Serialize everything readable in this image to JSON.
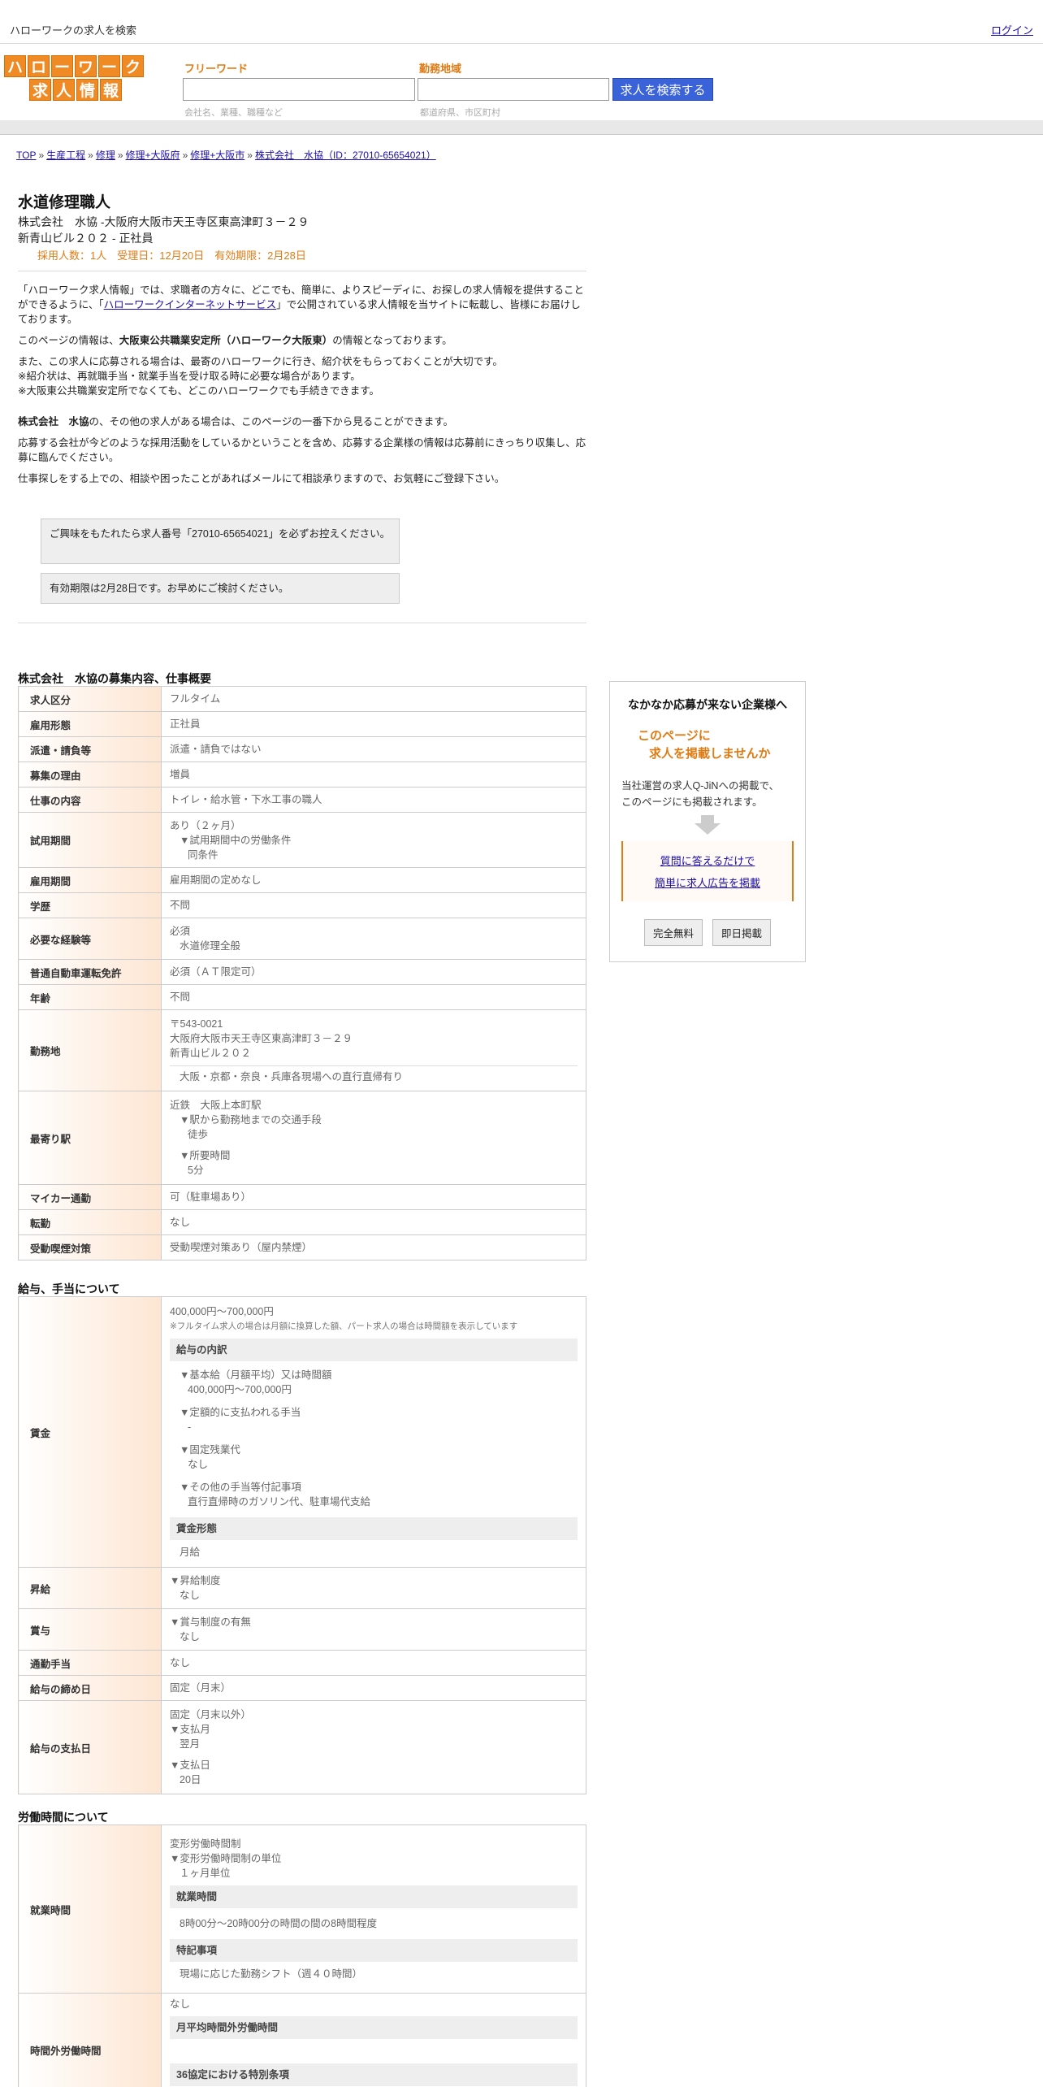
{
  "topbar": {
    "site_title": "ハローワークの求人を検索",
    "login": "ログイン"
  },
  "logo": {
    "row1": [
      "ハ",
      "ロ",
      "ー",
      "ワ",
      "ー",
      "ク"
    ],
    "row2": [
      "求",
      "人",
      "情",
      "報"
    ],
    "brand_color": "#f08a24"
  },
  "search": {
    "keyword_label": "フリーワード",
    "keyword_hint": "会社名、業種、職種など",
    "area_label": "勤務地域",
    "area_hint": "都道府県、市区町村",
    "button": "求人を検索する"
  },
  "breadcrumb": [
    "TOP",
    "生産工程",
    "修理",
    "修理+大阪府",
    "修理+大阪市",
    "株式会社　水協（ID：27010-65654021）"
  ],
  "job": {
    "title": "水道修理職人",
    "company_line1": "株式会社　水協 -大阪府大阪市天王寺区東高津町３－２９",
    "company_line2": "新青山ビル２０２ - 正社員",
    "meta": "採用人数：1人　受理日：12月20日　有効期限：2月28日"
  },
  "intro": {
    "p1_a": "「ハローワーク求人情報」では、求職者の方々に、どこでも、簡単に、よりスピーディに、お探しの求人情報を提供することができるように、「",
    "p1_link": "ハローワークインターネットサービス",
    "p1_b": "」で公開されている求人情報を当サイトに転載し、皆様にお届けしております。",
    "p2_a": "このページの情報は、",
    "p2_bold": "大阪東公共職業安定所（ハローワーク大阪東）",
    "p2_b": "の情報となっております。",
    "p3_1": "また、この求人に応募される場合は、最寄のハローワークに行き、紹介状をもらっておくことが大切です。",
    "p3_2": "※紹介状は、再就職手当・就業手当を受け取る時に必要な場合があります。",
    "p3_3": "※大阪東公共職業安定所でなくても、どこのハローワークでも手続きできます。",
    "p4_bold": "株式会社　水協",
    "p4": "の、その他の求人がある場合は、このページの一番下から見ることができます。",
    "p5": "応募する会社が今どのような採用活動をしているかということを含め、応募する企業様の情報は応募前にきっちり収集し、応募に臨んでください。",
    "p6": "仕事探しをする上での、相談や困ったことがあればメールにて相談承りますので、お気軽にご登録下さい。"
  },
  "notices": [
    "ご興味をもたれたら求人番号「27010-65654021」を必ずお控えください。",
    "有効期限は2月28日です。お早めにご検討ください。"
  ],
  "sections": {
    "summary": "株式会社　水協の募集内容、仕事概要",
    "salary": "給与、手当について",
    "hours": "労働時間について"
  },
  "summary_table": {
    "employment_type": {
      "label": "求人区分",
      "value": "フルタイム"
    },
    "form": {
      "label": "雇用形態",
      "value": "正社員"
    },
    "dispatch": {
      "label": "派遣・請負等",
      "value": "派遣・請負ではない"
    },
    "reason": {
      "label": "募集の理由",
      "value": "増員"
    },
    "work": {
      "label": "仕事の内容",
      "value": "トイレ・給水管・下水工事の職人"
    },
    "trial": {
      "label": "試用期間",
      "v1": "あり（２ヶ月）",
      "v2": "▼試用期間中の労働条件",
      "v3": "同条件"
    },
    "term": {
      "label": "雇用期間",
      "value": "雇用期間の定めなし"
    },
    "education": {
      "label": "学歴",
      "value": "不問"
    },
    "experience": {
      "label": "必要な経験等",
      "v1": "必須",
      "v2": "水道修理全般"
    },
    "license": {
      "label": "普通自動車運転免許",
      "value": "必須（ＡＴ限定可）"
    },
    "age": {
      "label": "年齢",
      "value": "不問"
    },
    "location": {
      "label": "勤務地",
      "v1": "〒543-0021",
      "v2": "大阪府大阪市天王寺区東高津町３－２９",
      "v3": "新青山ビル２０２",
      "v4": "大阪・京都・奈良・兵庫各現場への直行直帰有り"
    },
    "station": {
      "label": "最寄り駅",
      "v1": "近鉄　大阪上本町駅",
      "v2": "▼駅から勤務地までの交通手段",
      "v3": "徒歩",
      "v4": "▼所要時間",
      "v5": "5分"
    },
    "car": {
      "label": "マイカー通勤",
      "value": "可（駐車場あり）"
    },
    "transfer": {
      "label": "転勤",
      "value": "なし"
    },
    "smoking": {
      "label": "受動喫煙対策",
      "value": "受動喫煙対策あり（屋内禁煙）"
    }
  },
  "salary_table": {
    "wage": {
      "label": "賃金",
      "range": "400,000円〜700,000円",
      "note": "※フルタイム求人の場合は月額に換算した額、パート求人の場合は時間額を表示しています",
      "breakdown_head": "給与の内訳",
      "base_label": "▼基本給（月額平均）又は時間額",
      "base_value": "400,000円〜700,000円",
      "fixed_label": "▼定額的に支払われる手当",
      "fixed_value": "-",
      "overtime_label": "▼固定残業代",
      "overtime_value": "なし",
      "other_label": "▼その他の手当等付記事項",
      "other_value": "直行直帰時のガソリン代、駐車場代支給",
      "form_head": "賃金形態",
      "form_value": "月給"
    },
    "raise": {
      "label": "昇給",
      "v1": "▼昇給制度",
      "v2": "なし"
    },
    "bonus": {
      "label": "賞与",
      "v1": "▼賞与制度の有無",
      "v2": "なし"
    },
    "commute": {
      "label": "通勤手当",
      "value": "なし"
    },
    "closing": {
      "label": "給与の締め日",
      "value": "固定（月末）"
    },
    "payday": {
      "label": "給与の支払日",
      "v1": "固定（月末以外）",
      "v2": "▼支払月",
      "v3": "翌月",
      "v4": "▼支払日",
      "v5": "20日"
    }
  },
  "hours_table": {
    "work_hours": {
      "label": "就業時間",
      "v1": "変形労働時間制",
      "v2": "▼変形労働時間制の単位",
      "v3": "１ヶ月単位",
      "head1": "就業時間",
      "v4": "8時00分〜20時00分の時間の間の8時間程度",
      "head2": "特記事項",
      "v5": "現場に応じた勤務シフト（週４０時間）"
    },
    "overtime": {
      "label": "時間外労働時間",
      "v1": "なし",
      "head1": "月平均時間外労働時間",
      "head2": "36協定における特別条項"
    }
  },
  "ad": {
    "title": "なかなか応募が来ない企業様へ",
    "catch1": "このページに",
    "catch2": "求人を掲載しませんか",
    "text1": "当社運営の求人Q-JiNへの掲載で、",
    "text2": "このページにも掲載されます。",
    "link1": "質問に答えるだけで",
    "link2": "簡単に求人広告を掲載",
    "btn1": "完全無料",
    "btn2": "即日掲載",
    "accent": "#e07b13"
  }
}
